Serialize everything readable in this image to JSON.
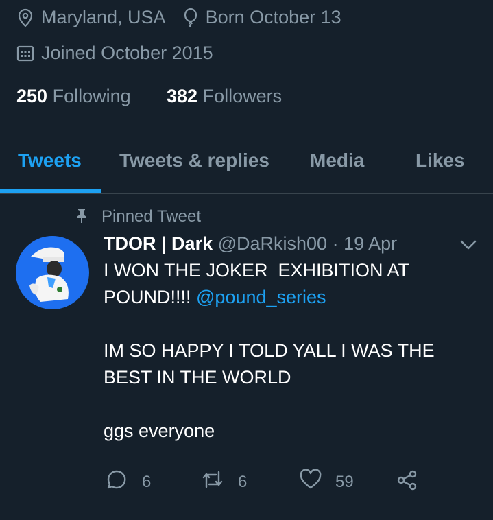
{
  "profile": {
    "location": "Maryland, USA",
    "birthday": "Born October 13",
    "joined": "Joined October 2015",
    "following_count": "250",
    "following_label": "Following",
    "followers_count": "382",
    "followers_label": "Followers"
  },
  "tabs": [
    {
      "label": "Tweets",
      "active": true
    },
    {
      "label": "Tweets & replies",
      "active": false
    },
    {
      "label": "Media",
      "active": false
    },
    {
      "label": "Likes",
      "active": false
    }
  ],
  "tweet": {
    "pinned_label": "Pinned Tweet",
    "display_name": "TDOR | Dark",
    "handle": "@DaRkish00",
    "separator": "·",
    "date": "19 Apr",
    "text_line1": "I WON THE JOKER  EXHIBITION AT",
    "text_line2_prefix": "POUND!!!! ",
    "mention": "@pound_series",
    "text_para2_line1": "IM SO HAPPY I TOLD YALL I WAS THE",
    "text_para2_line2": "BEST IN THE WORLD",
    "text_para3": "ggs everyone",
    "reply_count": "6",
    "retweet_count": "6",
    "like_count": "59"
  },
  "colors": {
    "background": "#15202b",
    "accent": "#1da1f2",
    "muted": "#8899a6",
    "divider": "#38444d"
  },
  "icons": [
    "location-pin-icon",
    "birthday-balloon-icon",
    "calendar-icon",
    "pin-icon",
    "chevron-down-icon",
    "reply-icon",
    "retweet-icon",
    "like-icon",
    "share-icon"
  ]
}
